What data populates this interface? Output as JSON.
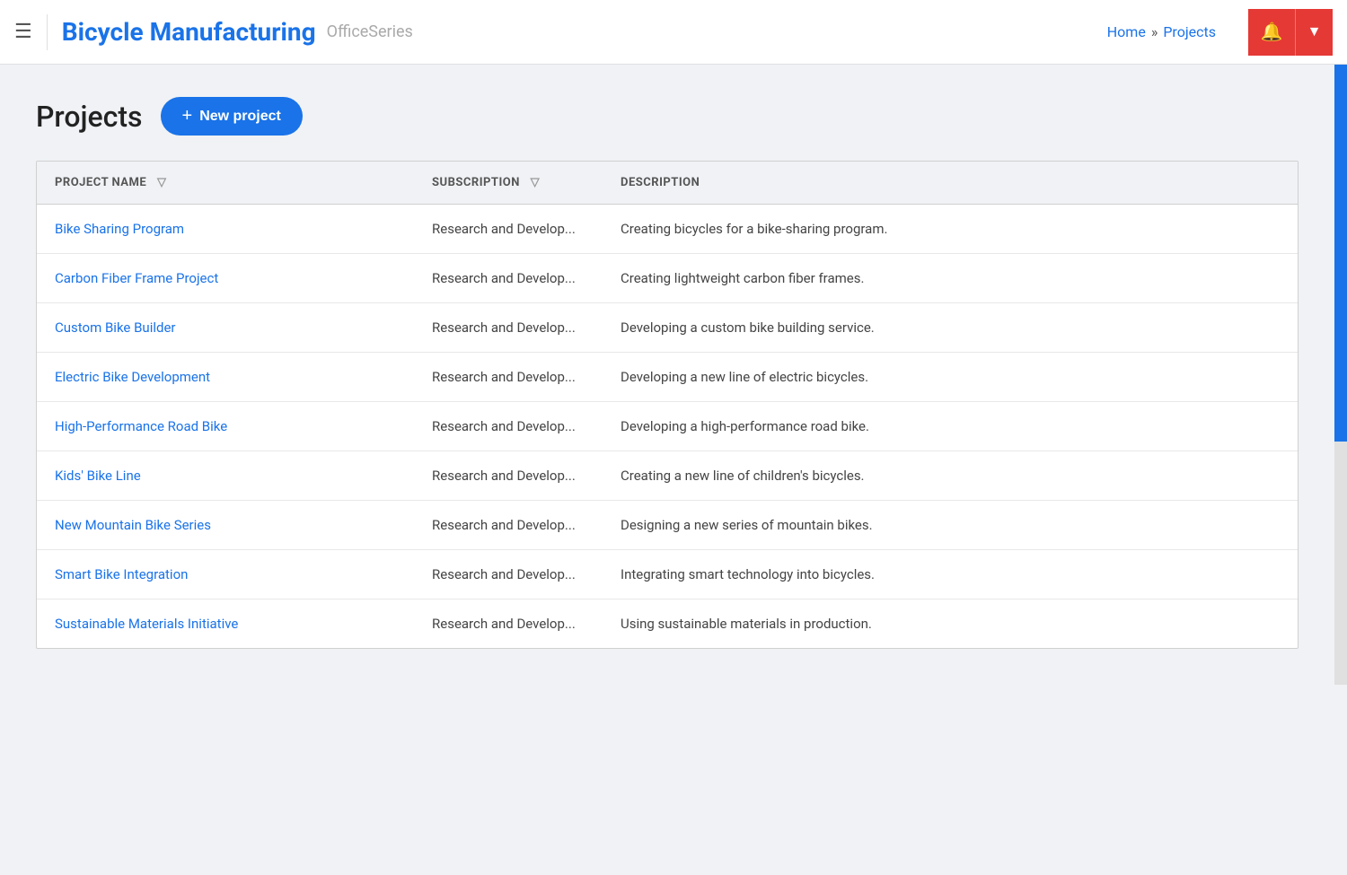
{
  "header": {
    "menu_label": "☰",
    "title": "Bicycle Manufacturing",
    "subtitle": "OfficeSeries",
    "nav": {
      "home": "Home",
      "separator": "»",
      "current": "Projects"
    },
    "bell_icon": "🔔",
    "dropdown_icon": "▼"
  },
  "page": {
    "title": "Projects",
    "new_project_btn": "+ New project",
    "new_project_plus": "+"
  },
  "table": {
    "columns": [
      {
        "key": "project_name",
        "label": "PROJECT NAME",
        "has_filter": true
      },
      {
        "key": "subscription",
        "label": "SUBSCRIPTION",
        "has_filter": true
      },
      {
        "key": "description",
        "label": "DESCRIPTION",
        "has_filter": false
      }
    ],
    "rows": [
      {
        "project_name": "Bike Sharing Program",
        "subscription": "Research and Develop...",
        "description": "Creating bicycles for a bike-sharing program."
      },
      {
        "project_name": "Carbon Fiber Frame Project",
        "subscription": "Research and Develop...",
        "description": "Creating lightweight carbon fiber frames."
      },
      {
        "project_name": "Custom Bike Builder",
        "subscription": "Research and Develop...",
        "description": "Developing a custom bike building service."
      },
      {
        "project_name": "Electric Bike Development",
        "subscription": "Research and Develop...",
        "description": "Developing a new line of electric bicycles."
      },
      {
        "project_name": "High-Performance Road Bike",
        "subscription": "Research and Develop...",
        "description": "Developing a high-performance road bike."
      },
      {
        "project_name": "Kids' Bike Line",
        "subscription": "Research and Develop...",
        "description": "Creating a new line of children's bicycles."
      },
      {
        "project_name": "New Mountain Bike Series",
        "subscription": "Research and Develop...",
        "description": "Designing a new series of mountain bikes."
      },
      {
        "project_name": "Smart Bike Integration",
        "subscription": "Research and Develop...",
        "description": "Integrating smart technology into bicycles."
      },
      {
        "project_name": "Sustainable Materials Initiative",
        "subscription": "Research and Develop...",
        "description": "Using sustainable materials in production."
      }
    ]
  },
  "colors": {
    "brand_blue": "#1a73e8",
    "brand_red": "#e53935",
    "header_bg": "#ffffff",
    "table_header_bg": "#f0f2f5",
    "page_bg": "#f0f2f5"
  }
}
